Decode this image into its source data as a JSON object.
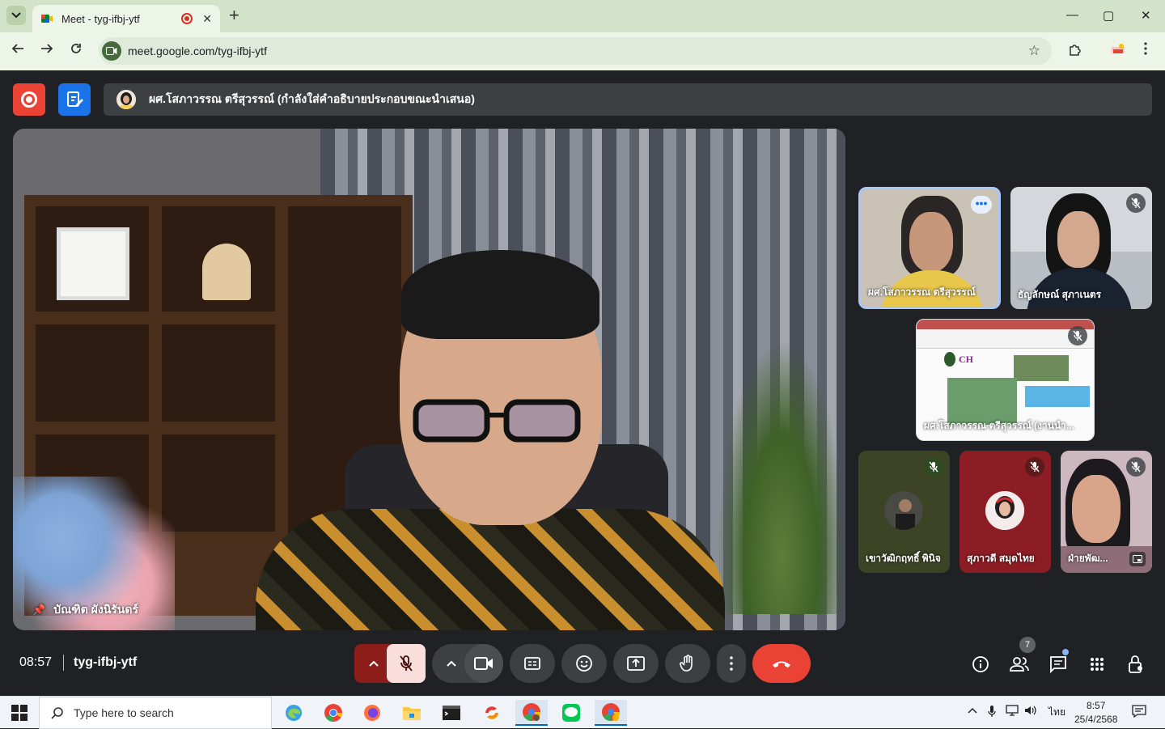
{
  "browser": {
    "tab_title": "Meet - tyg-ifbj-ytf",
    "url": "meet.google.com/tyg-ifbj-ytf",
    "new_tab_label": "+",
    "tab_close": "✕",
    "minimize": "—",
    "maximize": "▢",
    "close": "✕"
  },
  "meet": {
    "presenter_banner": "ผศ.โสภาวรรณ ตรีสุวรรณ์ (กำลังใส่คำอธิบายประกอบขณะนำเสนอ)",
    "main_speaker": "บัณฑิต ผังนิรันดร์",
    "tiles": [
      {
        "name": "ผศ.โสภาวรรณ ตรีสุวรรณ์",
        "muted": false,
        "speaking": true
      },
      {
        "name": "ธัญลักษณ์ สุภาเนตร",
        "muted": true
      },
      {
        "name": "ผศ.โสภาวรรณ ตรีสุวรรณ์ (งานนำ...",
        "muted": true,
        "type": "presentation"
      },
      {
        "name": "เขาวัฒิกฤทธิ์ พินิจ",
        "muted": true
      },
      {
        "name": "สุภาวดี สมุดไทย",
        "muted": true
      },
      {
        "name": "ฝ่ายพัฒ...",
        "muted": true
      }
    ],
    "clock": "08:57",
    "meeting_code": "tyg-ifbj-ytf",
    "participant_count": "7"
  },
  "taskbar": {
    "search_placeholder": "Type here to search",
    "language": "ไทย",
    "time": "8:57",
    "date": "25/4/2568"
  },
  "colors": {
    "end_call": "#ea4335",
    "mic_muted_bg": "#f9dedc",
    "accent_blue": "#1a73e8"
  }
}
